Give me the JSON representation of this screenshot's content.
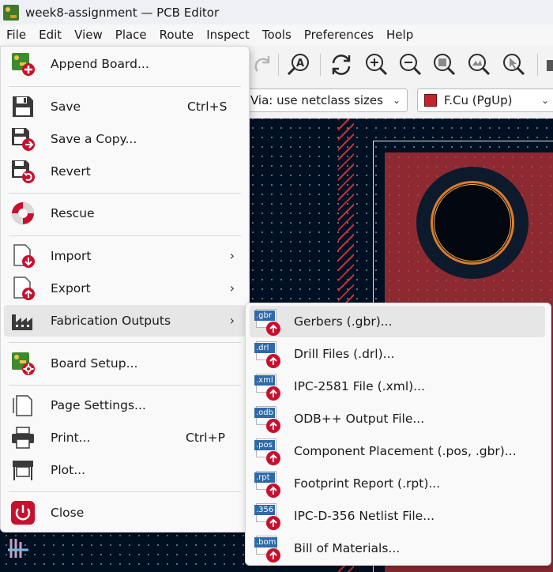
{
  "window": {
    "title": "week8-assignment — PCB Editor"
  },
  "menubar": {
    "items": [
      "File",
      "Edit",
      "View",
      "Place",
      "Route",
      "Inspect",
      "Tools",
      "Preferences",
      "Help"
    ]
  },
  "toolbar2": {
    "via_combo": "Via: use netclass sizes",
    "layer_combo": "F.Cu (PgUp)",
    "layer_color": "#c2262b"
  },
  "file_menu": {
    "append_board": "Append Board...",
    "save": "Save",
    "save_shortcut": "Ctrl+S",
    "save_copy": "Save a Copy...",
    "revert": "Revert",
    "rescue": "Rescue",
    "import": "Import",
    "export": "Export",
    "fabrication_outputs": "Fabrication Outputs",
    "board_setup": "Board Setup...",
    "page_settings": "Page Settings...",
    "print": "Print...",
    "print_shortcut": "Ctrl+P",
    "plot": "Plot...",
    "close": "Close"
  },
  "fab_submenu": {
    "items": [
      {
        "tag": ".gbr",
        "label": "Gerbers (.gbr)..."
      },
      {
        "tag": ".drl",
        "label": "Drill Files (.drl)..."
      },
      {
        "tag": ".xml",
        "label": "IPC-2581 File (.xml)..."
      },
      {
        "tag": ".odb",
        "label": "ODB++ Output File..."
      },
      {
        "tag": ".pos",
        "label": "Component Placement (.pos, .gbr)..."
      },
      {
        "tag": ".rpt",
        "label": "Footprint Report (.rpt)..."
      },
      {
        "tag": ".356",
        "label": "IPC-D-356 Netlist File..."
      },
      {
        "tag": ".bom",
        "label": "Bill of Materials..."
      }
    ]
  },
  "colors": {
    "canvas_bg": "#001023",
    "copper": "#8d2a31",
    "accent_red": "#c8102e",
    "tag_blue": "#2f6aa8"
  }
}
